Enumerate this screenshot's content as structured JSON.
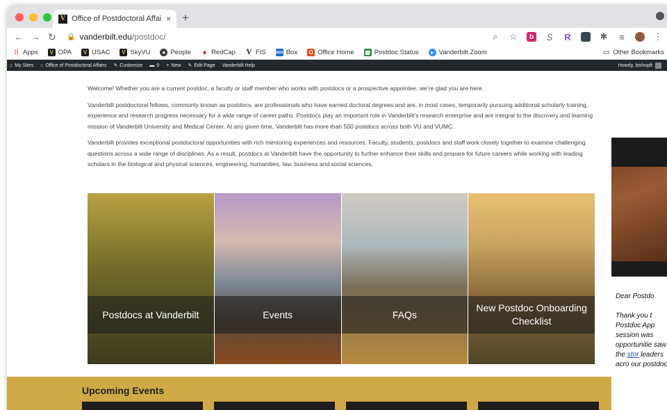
{
  "browser": {
    "tab_title": "Office of Postdoctoral Affairs |",
    "tab_close": "×",
    "new_tab": "+",
    "url_host": "vanderbilt.edu",
    "url_path": "/postdoc/",
    "bookmarks": [
      {
        "label": "Apps",
        "icon": "apps-grid-icon",
        "color": "#e94235"
      },
      {
        "label": "OPA",
        "icon": "vu-logo-icon",
        "color": "#1c1c1c"
      },
      {
        "label": "USAC",
        "icon": "vu-logo-icon",
        "color": "#1c1c1c"
      },
      {
        "label": "SkyVU",
        "icon": "vu-logo-icon",
        "color": "#1c1c1c"
      },
      {
        "label": "People",
        "icon": "people-icon",
        "color": "#3b3b3b"
      },
      {
        "label": "RedCap",
        "icon": "redcap-icon",
        "color": "#c62828"
      },
      {
        "label": "FIS",
        "icon": "v-logo-icon",
        "color": "#333333"
      },
      {
        "label": "Box",
        "icon": "box-icon",
        "color": "#1e6fd9"
      },
      {
        "label": "Office Home",
        "icon": "office-icon",
        "color": "#e64a19"
      },
      {
        "label": "Postdoc Status",
        "icon": "sheet-icon",
        "color": "#1e8e3e"
      },
      {
        "label": "Vanderbilt.Zoom",
        "icon": "zoom-icon",
        "color": "#2d8cff"
      }
    ],
    "other_bookmarks": "Other Bookmarks"
  },
  "adminbar": {
    "items": [
      "My Sites",
      "Office of Postdoctoral Affairs",
      "Customize",
      "0",
      "New",
      "Edit Page",
      "Vanderbilt Help"
    ],
    "howdy": "Howdy, bishopft"
  },
  "main": {
    "paragraphs": [
      "Welcome! Whether you are a current postdoc, a faculty or staff member who works with postdocs or a prospective appointee, we’re glad you are here.",
      "Vanderbilt postdoctoral fellows, commonly known as postdocs, are professionals who have earned doctoral degrees and are, in most cases, temporarily pursuing additional scholarly training, experience and research progress necessary for a wide range of career paths. Postdocs play an important role in Vanderbilt’s research enterprise and are integral to the discovery and learning mission of Vanderbilt University and Medical Center. At any given time, Vanderbilt has more than 500 postdocs across both VU and VUMC.",
      "Vanderbilt provides exceptional postdoctoral opportunities with rich mentoring experiences and resources. Faculty, students, postdocs and staff work closely together to examine challenging questions across a wide range of disciplines. As a result, postdocs at Vanderbilt have the opportunity to further enhance their skills and prepare for future careers while working with leading scholars in the biological and physical sciences, engineering, humanities, law, business and social sciences."
    ],
    "tiles": [
      {
        "label": "Postdocs at Vanderbilt"
      },
      {
        "label": "Events"
      },
      {
        "label": "FAQs"
      },
      {
        "label": "New Postdoc Onboarding Checklist"
      }
    ],
    "events_heading": "Upcoming Events"
  },
  "side_panel": {
    "greeting": "Dear Postdo",
    "body_start": "Thank you t Postdoc App session was opportunitie saw the",
    "link": "stor",
    "body_end": "leaders acro our postdoc"
  },
  "colors": {
    "adminbar": "#23282d",
    "events_band": "#cfa847",
    "accent_link": "#1a55c9"
  }
}
